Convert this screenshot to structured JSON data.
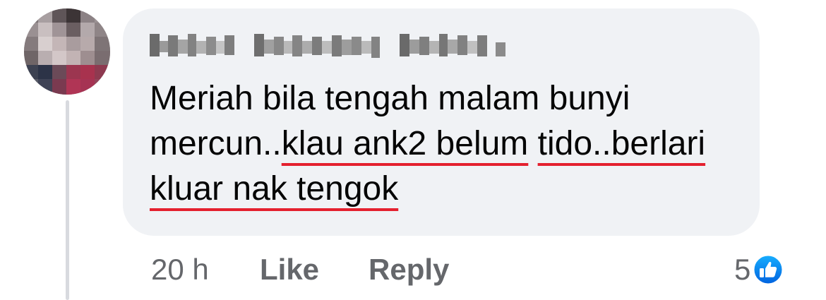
{
  "comment": {
    "author_name": "Hafiz Hashim Fakir",
    "text_before_underline": "Meriah bila tengah malam bunyi mercun..",
    "text_underlined_line1": "klau ank2 belum",
    "text_underlined_line2": "tido..berlari kluar nak tengok",
    "timestamp": "20 h",
    "like_label": "Like",
    "reply_label": "Reply",
    "reaction_count": "5",
    "reaction_icon": "thumbs-up-icon"
  },
  "colors": {
    "bubble_background": "#f0f2f5",
    "text": "#050505",
    "secondary_text": "#65676b",
    "underline": "#e4202e",
    "like_blue": "#1877f2",
    "thread_line": "#d8dadf"
  }
}
